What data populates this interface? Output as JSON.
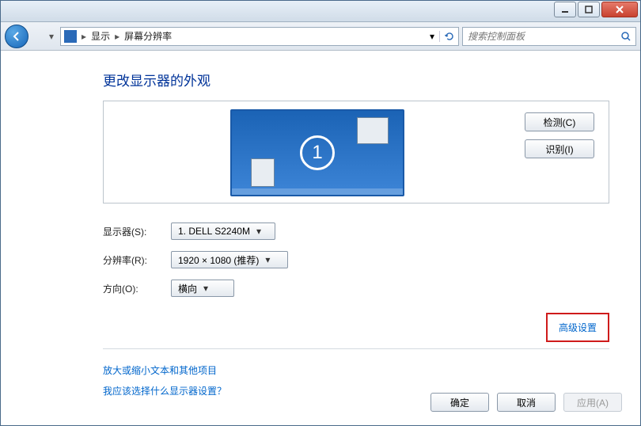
{
  "breadcrumb": {
    "seg1": "显示",
    "seg2": "屏幕分辨率"
  },
  "search": {
    "placeholder": "搜索控制面板"
  },
  "page": {
    "heading": "更改显示器的外观"
  },
  "monitor": {
    "number": "1",
    "detect_label": "检测(C)",
    "identify_label": "识别(I)"
  },
  "form": {
    "display_label": "显示器(S):",
    "display_value": "1. DELL S2240M",
    "resolution_label": "分辨率(R):",
    "resolution_value": "1920 × 1080 (推荐)",
    "orientation_label": "方向(O):",
    "orientation_value": "横向"
  },
  "links": {
    "advanced": "高级设置",
    "text_size": "放大或缩小文本和其他项目",
    "help_choose": "我应该选择什么显示器设置？"
  },
  "buttons": {
    "ok": "确定",
    "cancel": "取消",
    "apply": "应用(A)"
  }
}
